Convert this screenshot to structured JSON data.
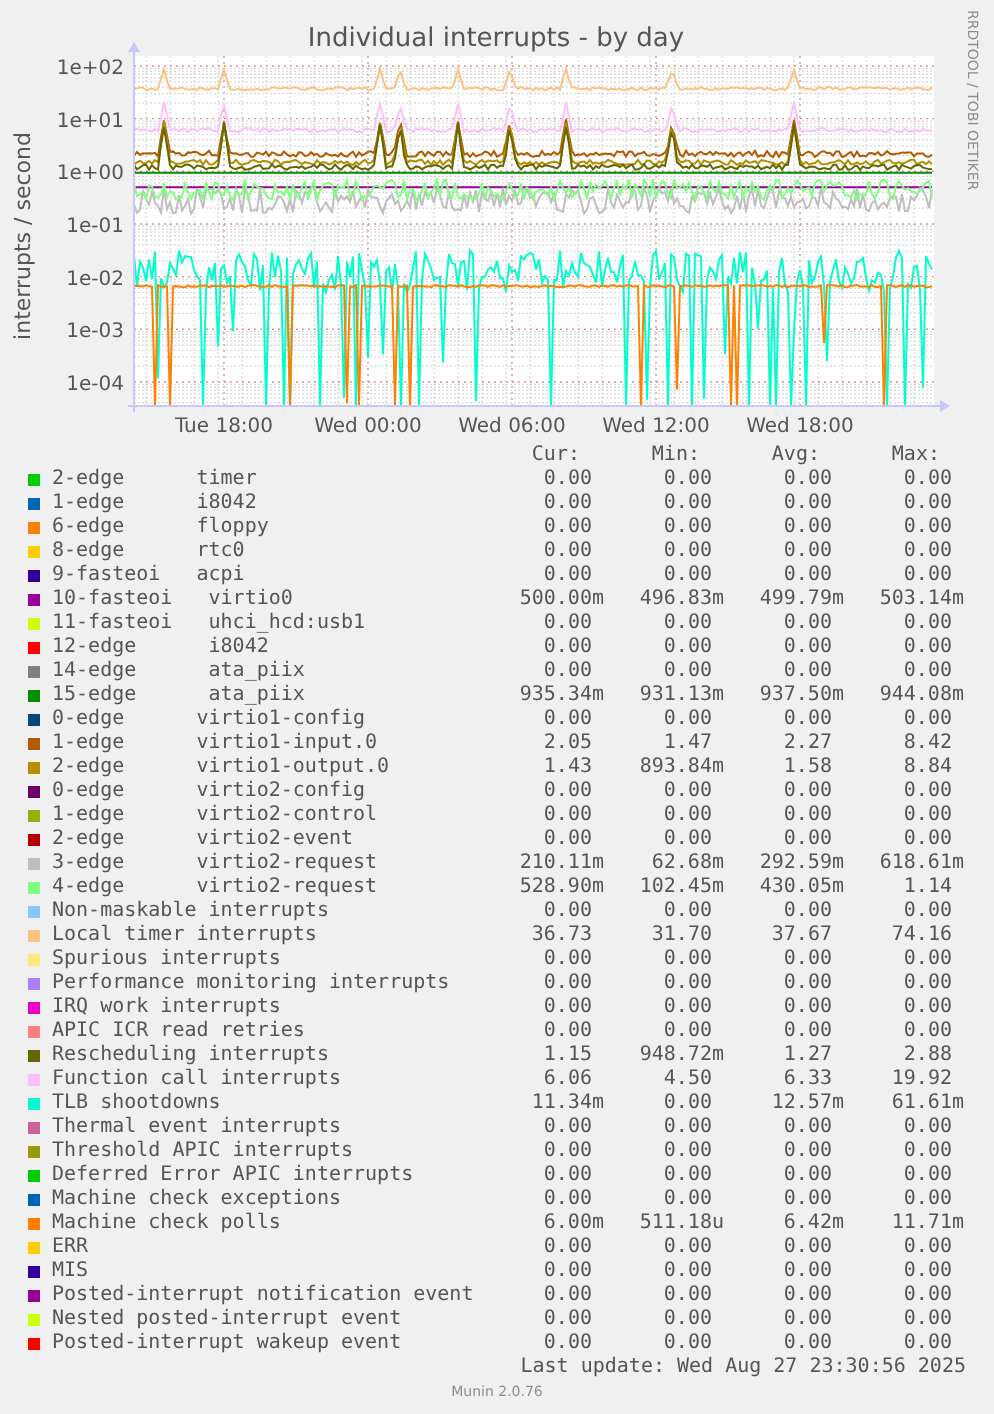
{
  "chart": {
    "title": "Individual interrupts - by day",
    "ylabel": "interrupts / second",
    "credit": "RRDTOOL / TOBI OETIKER",
    "yticks": [
      "1e+02",
      "1e+01",
      "1e+00",
      "1e-01",
      "1e-02",
      "1e-03",
      "1e-04"
    ],
    "xticks": [
      "Tue 18:00",
      "Wed 00:00",
      "Wed 06:00",
      "Wed 12:00",
      "Wed 18:00"
    ]
  },
  "legend": {
    "columns": [
      "Cur:",
      "Min:",
      "Avg:",
      "Max:"
    ],
    "items": [
      {
        "label": "2-edge      timer",
        "color": "#00cc00",
        "cur": "0.00",
        "min": "0.00",
        "avg": "0.00",
        "max": "0.00"
      },
      {
        "label": "1-edge      i8042",
        "color": "#0066b3",
        "cur": "0.00",
        "min": "0.00",
        "avg": "0.00",
        "max": "0.00"
      },
      {
        "label": "6-edge      floppy",
        "color": "#ff8000",
        "cur": "0.00",
        "min": "0.00",
        "avg": "0.00",
        "max": "0.00"
      },
      {
        "label": "8-edge      rtc0",
        "color": "#ffcc00",
        "cur": "0.00",
        "min": "0.00",
        "avg": "0.00",
        "max": "0.00"
      },
      {
        "label": "9-fasteoi   acpi",
        "color": "#330099",
        "cur": "0.00",
        "min": "0.00",
        "avg": "0.00",
        "max": "0.00"
      },
      {
        "label": "10-fasteoi   virtio0",
        "color": "#990099",
        "cur": "500.00m",
        "min": "496.83m",
        "avg": "499.79m",
        "max": "503.14m"
      },
      {
        "label": "11-fasteoi   uhci_hcd:usb1",
        "color": "#ccff00",
        "cur": "0.00",
        "min": "0.00",
        "avg": "0.00",
        "max": "0.00"
      },
      {
        "label": "12-edge      i8042",
        "color": "#ff0000",
        "cur": "0.00",
        "min": "0.00",
        "avg": "0.00",
        "max": "0.00"
      },
      {
        "label": "14-edge      ata_piix",
        "color": "#808080",
        "cur": "0.00",
        "min": "0.00",
        "avg": "0.00",
        "max": "0.00"
      },
      {
        "label": "15-edge      ata_piix",
        "color": "#008f00",
        "cur": "935.34m",
        "min": "931.13m",
        "avg": "937.50m",
        "max": "944.08m"
      },
      {
        "label": "0-edge      virtio1-config",
        "color": "#00487d",
        "cur": "0.00",
        "min": "0.00",
        "avg": "0.00",
        "max": "0.00"
      },
      {
        "label": "1-edge      virtio1-input.0",
        "color": "#b35a00",
        "cur": "2.05",
        "min": "1.47",
        "avg": "2.27",
        "max": "8.42"
      },
      {
        "label": "2-edge      virtio1-output.0",
        "color": "#b38f00",
        "cur": "1.43",
        "min": "893.84m",
        "avg": "1.58",
        "max": "8.84"
      },
      {
        "label": "0-edge      virtio2-config",
        "color": "#6b006b",
        "cur": "0.00",
        "min": "0.00",
        "avg": "0.00",
        "max": "0.00"
      },
      {
        "label": "1-edge      virtio2-control",
        "color": "#8fb300",
        "cur": "0.00",
        "min": "0.00",
        "avg": "0.00",
        "max": "0.00"
      },
      {
        "label": "2-edge      virtio2-event",
        "color": "#b30000",
        "cur": "0.00",
        "min": "0.00",
        "avg": "0.00",
        "max": "0.00"
      },
      {
        "label": "3-edge      virtio2-request",
        "color": "#bebebe",
        "cur": "210.11m",
        "min": "62.68m",
        "avg": "292.59m",
        "max": "618.61m"
      },
      {
        "label": "4-edge      virtio2-request",
        "color": "#80ff80",
        "cur": "528.90m",
        "min": "102.45m",
        "avg": "430.05m",
        "max": "1.14"
      },
      {
        "label": "Non-maskable interrupts",
        "color": "#80c9ff",
        "cur": "0.00",
        "min": "0.00",
        "avg": "0.00",
        "max": "0.00"
      },
      {
        "label": "Local timer interrupts",
        "color": "#ffc080",
        "cur": "36.73",
        "min": "31.70",
        "avg": "37.67",
        "max": "74.16"
      },
      {
        "label": "Spurious interrupts",
        "color": "#ffe680",
        "cur": "0.00",
        "min": "0.00",
        "avg": "0.00",
        "max": "0.00"
      },
      {
        "label": "Performance monitoring interrupts",
        "color": "#aa80ff",
        "cur": "0.00",
        "min": "0.00",
        "avg": "0.00",
        "max": "0.00"
      },
      {
        "label": "IRQ work interrupts",
        "color": "#ee00cc",
        "cur": "0.00",
        "min": "0.00",
        "avg": "0.00",
        "max": "0.00"
      },
      {
        "label": "APIC ICR read retries",
        "color": "#ff8080",
        "cur": "0.00",
        "min": "0.00",
        "avg": "0.00",
        "max": "0.00"
      },
      {
        "label": "Rescheduling interrupts",
        "color": "#666600",
        "cur": "1.15",
        "min": "948.72m",
        "avg": "1.27",
        "max": "2.88"
      },
      {
        "label": "Function call interrupts",
        "color": "#ffbfff",
        "cur": "6.06",
        "min": "4.50",
        "avg": "6.33",
        "max": "19.92"
      },
      {
        "label": "TLB shootdowns",
        "color": "#00ffcc",
        "cur": "11.34m",
        "min": "0.00",
        "avg": "12.57m",
        "max": "61.61m"
      },
      {
        "label": "Thermal event interrupts",
        "color": "#cc6699",
        "cur": "0.00",
        "min": "0.00",
        "avg": "0.00",
        "max": "0.00"
      },
      {
        "label": "Threshold APIC interrupts",
        "color": "#999900",
        "cur": "0.00",
        "min": "0.00",
        "avg": "0.00",
        "max": "0.00"
      },
      {
        "label": "Deferred Error APIC interrupts",
        "color": "#00cc00",
        "cur": "0.00",
        "min": "0.00",
        "avg": "0.00",
        "max": "0.00"
      },
      {
        "label": "Machine check exceptions",
        "color": "#0066b3",
        "cur": "0.00",
        "min": "0.00",
        "avg": "0.00",
        "max": "0.00"
      },
      {
        "label": "Machine check polls",
        "color": "#ff8000",
        "cur": "6.00m",
        "min": "511.18u",
        "avg": "6.42m",
        "max": "11.71m"
      },
      {
        "label": "ERR",
        "color": "#ffcc00",
        "cur": "0.00",
        "min": "0.00",
        "avg": "0.00",
        "max": "0.00"
      },
      {
        "label": "MIS",
        "color": "#330099",
        "cur": "0.00",
        "min": "0.00",
        "avg": "0.00",
        "max": "0.00"
      },
      {
        "label": "Posted-interrupt notification event",
        "color": "#990099",
        "cur": "0.00",
        "min": "0.00",
        "avg": "0.00",
        "max": "0.00"
      },
      {
        "label": "Nested posted-interrupt event",
        "color": "#ccff00",
        "cur": "0.00",
        "min": "0.00",
        "avg": "0.00",
        "max": "0.00"
      },
      {
        "label": "Posted-interrupt wakeup event",
        "color": "#ff0000",
        "cur": "0.00",
        "min": "0.00",
        "avg": "0.00",
        "max": "0.00"
      }
    ]
  },
  "last_update": "Last update: Wed Aug 27 23:30:56 2025",
  "version": "Munin 2.0.76"
}
